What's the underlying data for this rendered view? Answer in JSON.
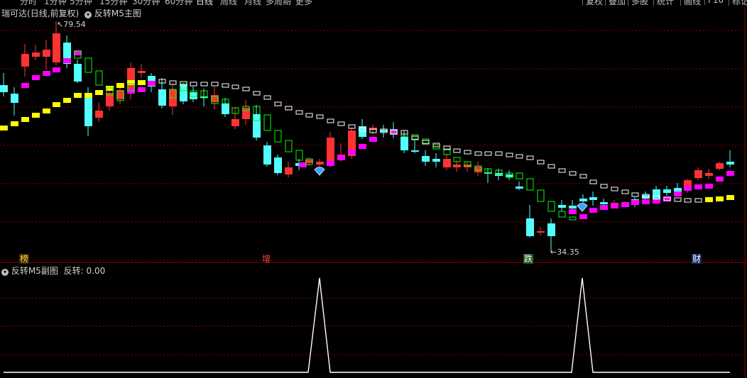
{
  "toolbar": {
    "periods": [
      "分时",
      "1分钟",
      "5分钟",
      "15分钟",
      "30分钟",
      "60分钟",
      "日线",
      "周线",
      "月线",
      "多周期",
      "更多"
    ],
    "active_period": "日线",
    "right_buttons": [
      "复权",
      "叠加",
      "多股",
      "统计",
      "画线",
      "F10",
      "标记"
    ]
  },
  "main_panel": {
    "stock_name": "瑞可达",
    "period_note": "(日线,前复权)",
    "indicator_name": "反转M5主图",
    "dropdown_icon": "chevron-down-icon",
    "high_label": "79.54",
    "low_label": "34.35",
    "markers": [
      "榜",
      "增",
      "跌",
      "财"
    ],
    "colors": {
      "up": "#ff3333",
      "down": "#54ffff",
      "ma_up": "#ff00ff",
      "ma_down": "#ffff00",
      "step": "#00ff00",
      "dash": "#ffffff",
      "grid": "#8a0000"
    },
    "signal_icon": "diamond-icon"
  },
  "sub_panel": {
    "indicator_name": "反转M5副图",
    "value_label": "反转: 0.00"
  },
  "chart_data": {
    "type": "candlestick",
    "y_range": [
      34.35,
      79.54
    ],
    "highest": 79.54,
    "lowest": 34.35,
    "sub_indicator": {
      "name": "反转",
      "current": 0.0,
      "signal_spikes": 2
    }
  }
}
